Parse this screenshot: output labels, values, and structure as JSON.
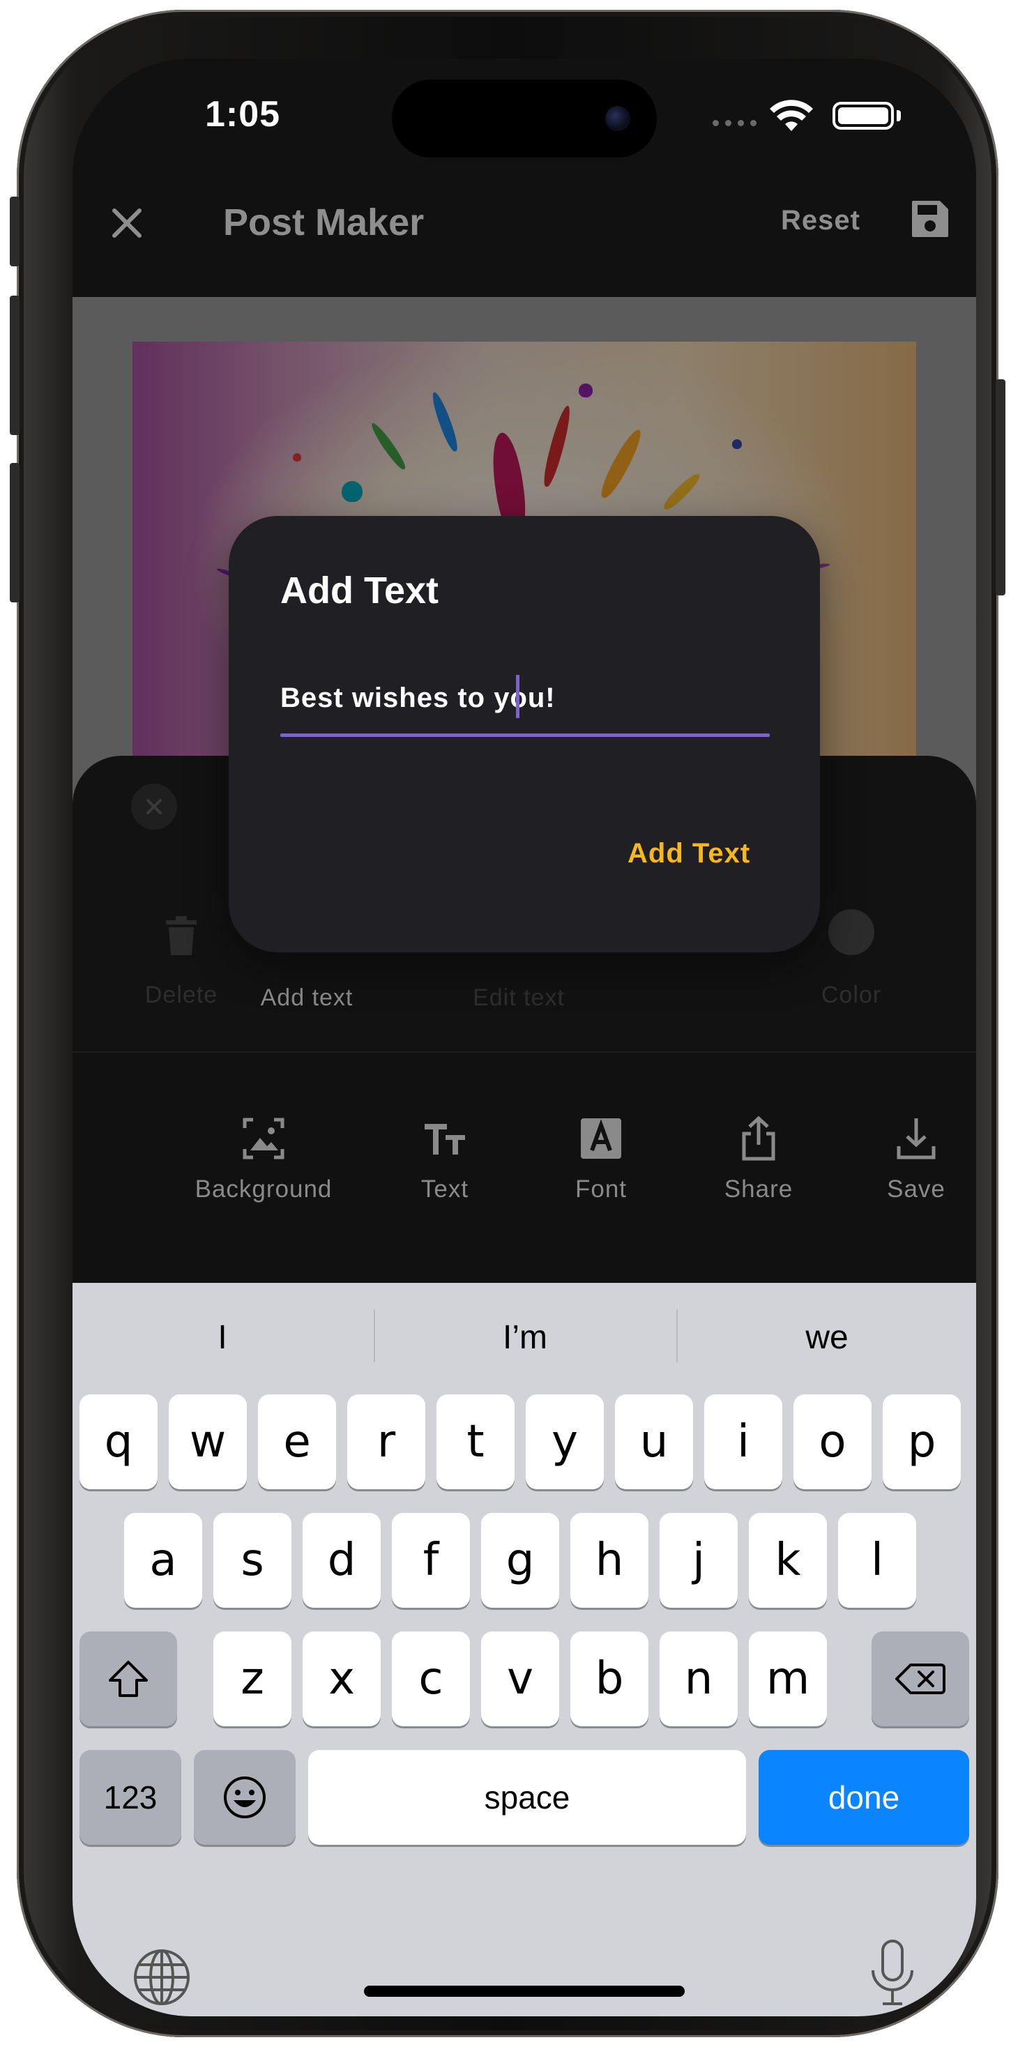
{
  "status_bar": {
    "time": "1:05"
  },
  "app_bar": {
    "title": "Post Maker",
    "reset_label": "Reset"
  },
  "sheet": {
    "actions": [
      {
        "label": "Delete",
        "icon": "trash-icon"
      },
      {
        "label": "Add text",
        "icon": "add-text-icon"
      },
      {
        "label": "Edit text",
        "icon": "edit-text-icon"
      },
      {
        "label": "Color",
        "icon": "color-swatch-icon"
      }
    ],
    "toolbar": [
      {
        "label": "Background",
        "icon": "image-frame-icon"
      },
      {
        "label": "Text",
        "icon": "text-size-icon"
      },
      {
        "label": "Font",
        "icon": "font-icon"
      },
      {
        "label": "Share",
        "icon": "share-icon"
      },
      {
        "label": "Save",
        "icon": "download-icon"
      }
    ]
  },
  "dialog": {
    "title": "Add Text",
    "input_value": "Best wishes to you!",
    "confirm_label": "Add Text",
    "accent_color": "#7c64c9",
    "button_color": "#f7b81d"
  },
  "keyboard": {
    "suggestions": [
      "I",
      "I’m",
      "we"
    ],
    "row1": [
      "q",
      "w",
      "e",
      "r",
      "t",
      "y",
      "u",
      "i",
      "o",
      "p"
    ],
    "row2": [
      "a",
      "s",
      "d",
      "f",
      "g",
      "h",
      "j",
      "k",
      "l"
    ],
    "row3": [
      "z",
      "x",
      "c",
      "v",
      "b",
      "n",
      "m"
    ],
    "numbers_label": "123",
    "space_label": "space",
    "done_label": "done",
    "done_color": "#0a84ff"
  }
}
